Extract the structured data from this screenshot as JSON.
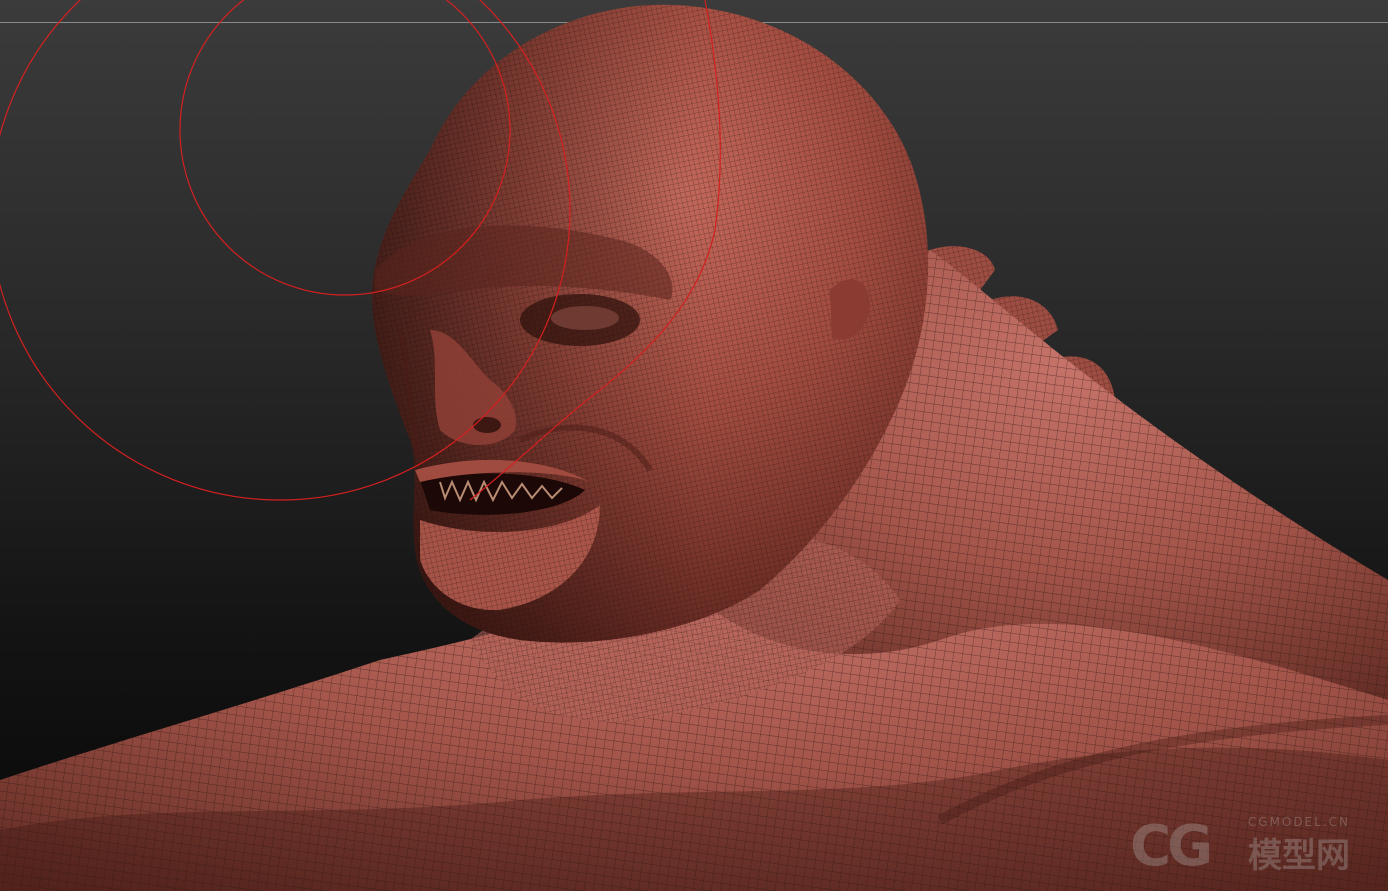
{
  "viewport": {
    "background_top": "#3b3b3b",
    "background_bottom": "#070707",
    "model_color": "#9a4a40",
    "wire_color": "#2b1512",
    "gizmo_color": "#d42020"
  },
  "watermark": {
    "logo_text": "CG",
    "site_text": "CGMODEL.CN",
    "cn_text": "模型网"
  }
}
